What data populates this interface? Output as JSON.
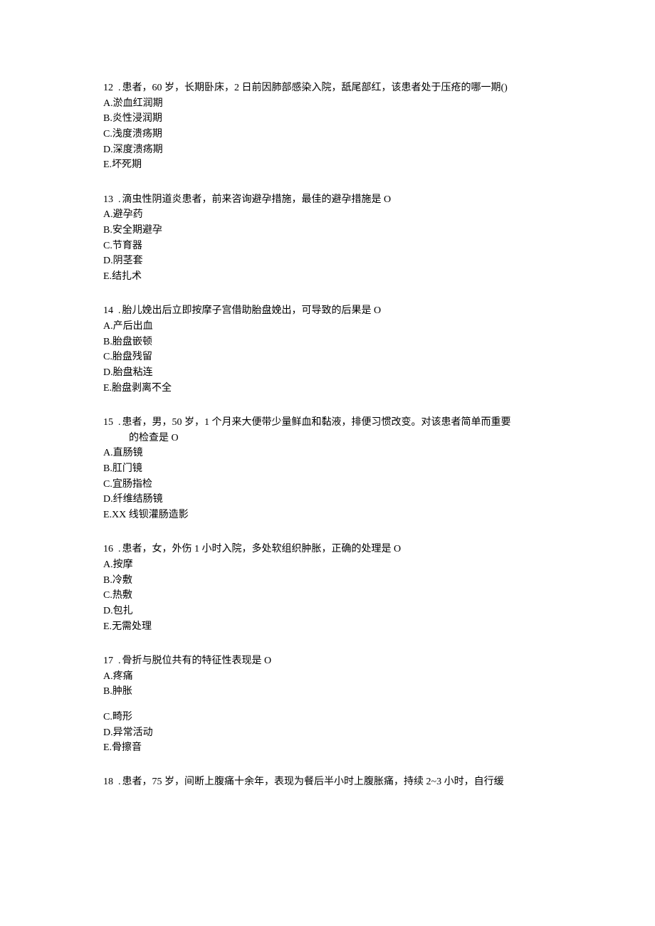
{
  "questions": [
    {
      "num": "12",
      "stem": "患者，60 岁，长期卧床，2 日前因肺部感染入院，舐尾部红，该患者处于压疮的哪一期()",
      "options": {
        "A": "淤血红润期",
        "B": "炎性浸润期",
        "C": "浅度溃疡期",
        "D": "深度溃疡期",
        "E": "坏死期"
      }
    },
    {
      "num": "13",
      "stem": "滴虫性阴道炎患者，前来咨询避孕措施，最佳的避孕措施是 O",
      "options": {
        "A": "避孕药",
        "B": "安全期避孕",
        "C": "节育器",
        "D": "阴茎套",
        "E": "结扎术"
      }
    },
    {
      "num": "14",
      "stem": "胎儿娩出后立即按摩子宫借助胎盘娩出，可导致的后果是 O",
      "options": {
        "A": "产后出血",
        "B": "胎盘嵌顿",
        "C": "胎盘残留",
        "D": "胎盘粘连",
        "E": "胎盘剥离不全"
      }
    },
    {
      "num": "15",
      "stem": "患者，男，50 岁，1 个月来大便带少量鲜血和黏液，排便习惯改变。对该患者简单而重要",
      "stem_cont": "的检查是 O",
      "options": {
        "A": "直肠镜",
        "B": "肛门镜",
        "C": "宜肠指检",
        "D": "纤维结肠镜",
        "E": "X 线钡灌肠造影"
      }
    },
    {
      "num": "16",
      "stem": "患者，女，外伤 1 小时入院，多处软组织肿胀，正确的处理是 O",
      "options": {
        "A": "按摩",
        "B": "冷敷",
        "C": "热敷",
        "D": "包扎",
        "E": "无需处理"
      }
    },
    {
      "num": "17",
      "stem": "骨折与脱位共有的特征性表现是 O",
      "options": {
        "A": "疼痛",
        "B": "肿胀",
        "C": "畸形",
        "D": "异常活动",
        "E": "骨擦音"
      },
      "gap_after_b": true
    },
    {
      "num": "18",
      "stem": "患者，75 岁，间断上腹痛十余年，表现为餐后半小时上腹胀痛，持续 2~3 小时，自行缓"
    }
  ],
  "labels": {
    "A": "A.",
    "B": "B.",
    "C": "C.",
    "D": "D.",
    "E": "E.",
    "EX": "E.X"
  }
}
